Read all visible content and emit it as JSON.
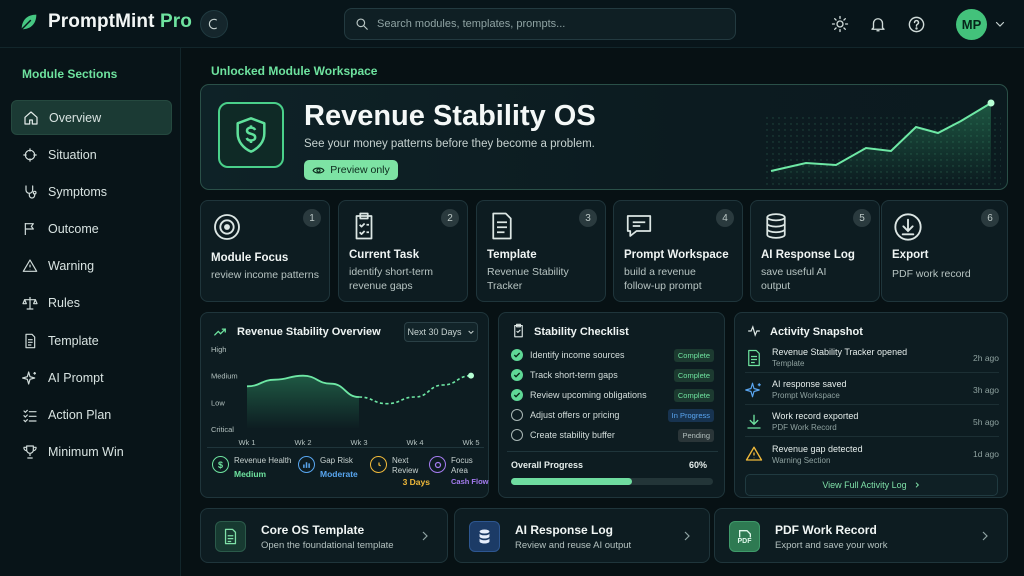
{
  "brand": {
    "name": "PromptMint",
    "suffix": "Pro"
  },
  "search": {
    "placeholder": "Search modules, templates, prompts..."
  },
  "user": {
    "initials": "MP"
  },
  "colors": {
    "accent": "#6ee39f",
    "background": "#071114",
    "panel": "#0d1c21",
    "info": "#3f8ef0",
    "warning": "#f0b93a",
    "purple": "#a57cf0"
  },
  "sidebar": {
    "title": "Module Sections",
    "items": [
      {
        "label": "Overview",
        "icon": "home-icon",
        "active": true
      },
      {
        "label": "Situation",
        "icon": "crosshair-icon"
      },
      {
        "label": "Symptoms",
        "icon": "stethoscope-icon"
      },
      {
        "label": "Outcome",
        "icon": "flag-icon"
      },
      {
        "label": "Warning",
        "icon": "warning-triangle-icon"
      },
      {
        "label": "Rules",
        "icon": "scale-icon"
      },
      {
        "label": "Template",
        "icon": "document-icon"
      },
      {
        "label": "AI Prompt",
        "icon": "sparkle-icon"
      },
      {
        "label": "Action Plan",
        "icon": "list-check-icon"
      },
      {
        "label": "Minimum Win",
        "icon": "trophy-icon"
      }
    ]
  },
  "workspace_label": "Unlocked Module Workspace",
  "hero": {
    "title": "Revenue Stability OS",
    "subtitle": "See your money patterns before they become a problem.",
    "preview_label": "Preview only",
    "icon": "shield-dollar-icon"
  },
  "steps": [
    {
      "num": "1",
      "title": "Module Focus",
      "desc": "review income patterns",
      "icon": "target-icon"
    },
    {
      "num": "2",
      "title": "Current Task",
      "desc": "identify short-term revenue gaps",
      "icon": "clipboard-check-icon"
    },
    {
      "num": "3",
      "title": "Template",
      "desc": "Revenue Stability Tracker",
      "icon": "document-icon"
    },
    {
      "num": "4",
      "title": "Prompt Workspace",
      "desc": "build a revenue follow-up prompt",
      "icon": "chat-bubble-icon"
    },
    {
      "num": "5",
      "title": "AI Response Log",
      "desc": "save useful AI output",
      "icon": "database-icon"
    },
    {
      "num": "6",
      "title": "Export",
      "desc": "PDF work record",
      "icon": "download-icon"
    }
  ],
  "overview": {
    "title": "Revenue Stability Overview",
    "range": "Next 30 Days",
    "chart_data": {
      "type": "line",
      "title": "Revenue Stability Overview",
      "categories": [
        "Wk 1",
        "Wk 2",
        "Wk 3",
        "Wk 4",
        "Wk 5"
      ],
      "y_levels": [
        "Critical",
        "Low",
        "Medium",
        "High"
      ],
      "x": [
        1,
        1.5,
        2,
        2.5,
        3,
        3.5,
        4,
        4.5,
        5
      ],
      "values": [
        1.6,
        1.85,
        2.0,
        1.7,
        1.2,
        0.95,
        1.2,
        1.65,
        2.0
      ],
      "projected_from_x": 3,
      "ylim": [
        0,
        3
      ],
      "grid": false
    },
    "metrics": [
      {
        "label": "Revenue Health",
        "value": "Medium",
        "color": "#6ee39f",
        "icon": "dollar-icon"
      },
      {
        "label": "Gap Risk",
        "value": "Moderate",
        "color": "#58a6f0",
        "icon": "bar-chart-icon"
      },
      {
        "label": "Next Review",
        "value": "3 Days",
        "color": "#f0b93a",
        "icon": "clock-icon"
      },
      {
        "label": "Focus Area",
        "value": "Cash Flow",
        "color": "#a57cf0",
        "icon": "target-icon"
      }
    ]
  },
  "checklist": {
    "title": "Stability Checklist",
    "items": [
      {
        "label": "Identify income sources",
        "status": "Complete",
        "done": true
      },
      {
        "label": "Track short-term gaps",
        "status": "Complete",
        "done": true
      },
      {
        "label": "Review upcoming obligations",
        "status": "Complete",
        "done": true
      },
      {
        "label": "Adjust offers or pricing",
        "status": "In Progress",
        "done": false
      },
      {
        "label": "Create stability buffer",
        "status": "Pending",
        "done": false
      }
    ],
    "progress_label": "Overall Progress",
    "progress_value": "60%",
    "progress_fraction": 0.6
  },
  "activity": {
    "title": "Activity Snapshot",
    "items": [
      {
        "title": "Revenue Stability Tracker opened",
        "sub": "Template",
        "time": "2h ago",
        "icon": "document-icon"
      },
      {
        "title": "AI response saved",
        "sub": "Prompt Workspace",
        "time": "3h ago",
        "icon": "sparkle-icon"
      },
      {
        "title": "Work record exported",
        "sub": "PDF Work Record",
        "time": "5h ago",
        "icon": "download-icon"
      },
      {
        "title": "Revenue gap detected",
        "sub": "Warning Section",
        "time": "1d ago",
        "icon": "warning-triangle-icon"
      }
    ],
    "view_all": "View Full Activity Log"
  },
  "bottom_cards": [
    {
      "title": "Core OS Template",
      "sub": "Open the foundational template",
      "icon": "document-icon"
    },
    {
      "title": "AI Response Log",
      "sub": "Review and reuse AI output",
      "icon": "database-icon"
    },
    {
      "title": "PDF Work Record",
      "sub": "Export and save your work",
      "icon": "pdf-icon",
      "icon_text": "PDF"
    }
  ]
}
